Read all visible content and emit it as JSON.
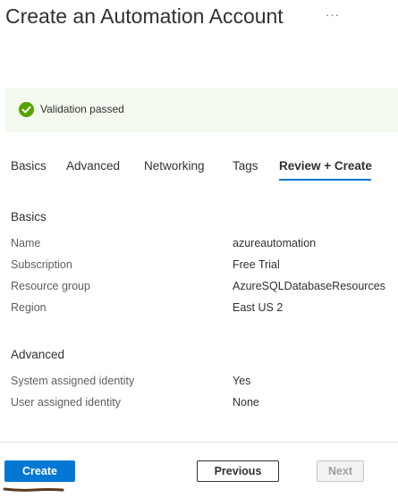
{
  "header": {
    "title": "Create an Automation Account",
    "more_icon": "more-options-icon",
    "more_text": "···"
  },
  "banner": {
    "icon": "success-check-icon",
    "text": "Validation passed",
    "color": "#57a300"
  },
  "tabs": [
    {
      "label": "Basics",
      "active": false
    },
    {
      "label": "Advanced",
      "active": false
    },
    {
      "label": "Networking",
      "active": false
    },
    {
      "label": "Tags",
      "active": false
    },
    {
      "label": "Review + Create",
      "active": true
    }
  ],
  "basics": {
    "heading": "Basics",
    "rows": [
      {
        "label": "Name",
        "value": "azureautomation"
      },
      {
        "label": "Subscription",
        "value": "Free Trial"
      },
      {
        "label": "Resource group",
        "value": "AzureSQLDatabaseResources"
      },
      {
        "label": "Region",
        "value": "East US 2"
      }
    ]
  },
  "advanced": {
    "heading": "Advanced",
    "rows": [
      {
        "label": "System assigned identity",
        "value": "Yes"
      },
      {
        "label": "User assigned identity",
        "value": "None"
      }
    ]
  },
  "footer": {
    "create_label": "Create",
    "previous_label": "Previous",
    "next_label": "Next"
  },
  "colors": {
    "accent": "#0078d4",
    "success": "#57a300",
    "annotation": "#5c3a1e"
  }
}
